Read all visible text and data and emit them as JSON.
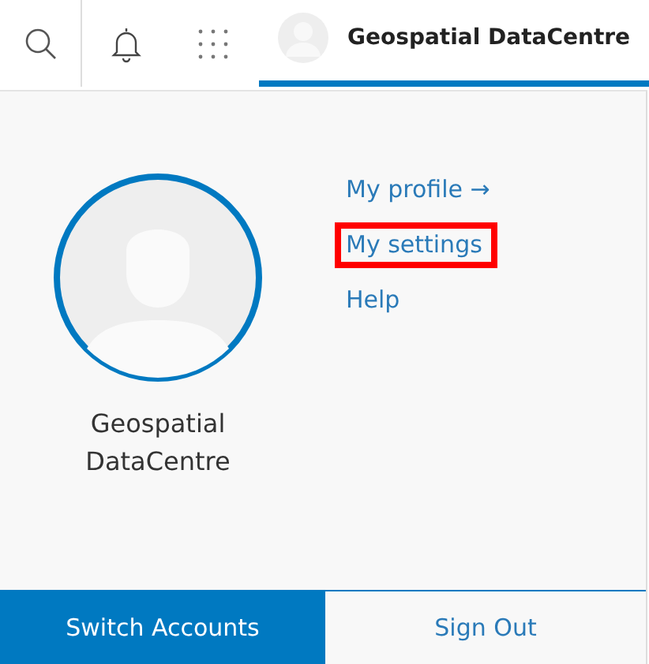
{
  "header": {
    "user_name": "Geospatial DataCentre",
    "expanded": true
  },
  "profile": {
    "name": "Geospatial DataCentre"
  },
  "links": [
    {
      "label": "My profile →",
      "highlighted": false
    },
    {
      "label": "My settings",
      "highlighted": true
    },
    {
      "label": "Help",
      "highlighted": false
    }
  ],
  "buttons": [
    {
      "label": "Switch Accounts",
      "kind": "primary"
    },
    {
      "label": "Sign Out",
      "kind": "secondary"
    }
  ]
}
